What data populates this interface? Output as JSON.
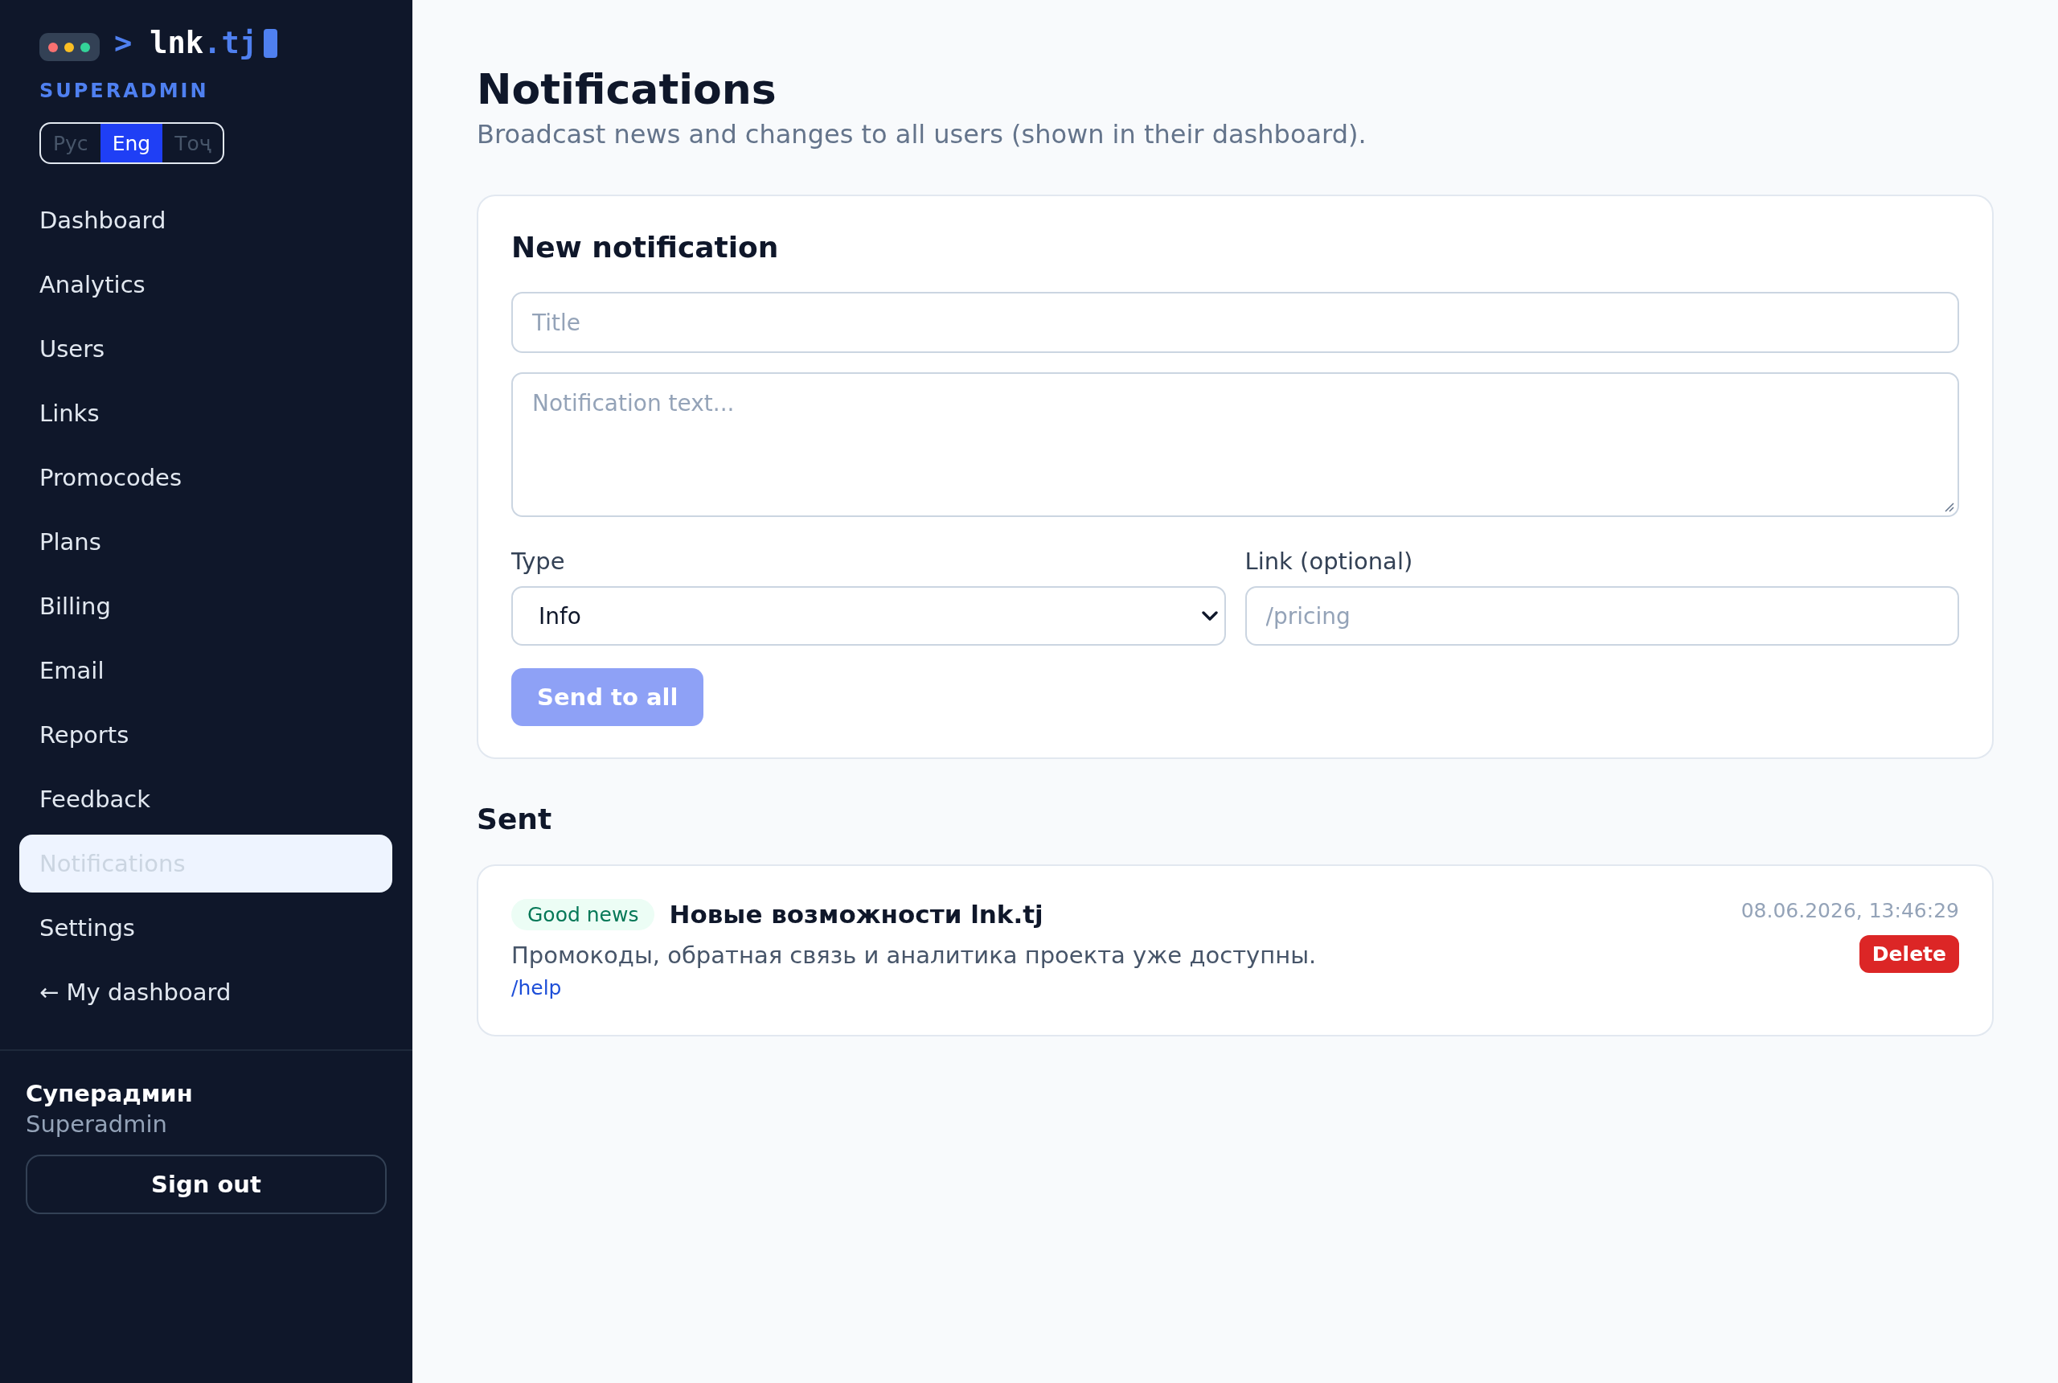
{
  "sidebar": {
    "logo": {
      "prompt": ">",
      "name": "lnk",
      "domain": ".tj"
    },
    "role": "SUPERADMIN",
    "languages": [
      {
        "label": "Рус",
        "selected": false
      },
      {
        "label": "Eng",
        "selected": true
      },
      {
        "label": "Тоҷ",
        "selected": false
      }
    ],
    "nav_items": [
      {
        "label": "Dashboard",
        "selected": false
      },
      {
        "label": "Analytics",
        "selected": false
      },
      {
        "label": "Users",
        "selected": false
      },
      {
        "label": "Links",
        "selected": false
      },
      {
        "label": "Promocodes",
        "selected": false
      },
      {
        "label": "Plans",
        "selected": false
      },
      {
        "label": "Billing",
        "selected": false
      },
      {
        "label": "Email",
        "selected": false
      },
      {
        "label": "Reports",
        "selected": false
      },
      {
        "label": "Feedback",
        "selected": false
      },
      {
        "label": "Notifications",
        "selected": true
      },
      {
        "label": "Settings",
        "selected": false
      },
      {
        "label": "← My dashboard",
        "selected": false
      }
    ],
    "user": {
      "name": "Суперадмин",
      "role": "Superadmin"
    },
    "sign_out_button": "Sign out"
  },
  "page": {
    "title": "Notifications",
    "subtitle": "Broadcast news and changes to all users (shown in their dashboard)."
  },
  "new_notification": {
    "heading": "New notification",
    "title_field": {
      "placeholder": "Title"
    },
    "text_field": {
      "placeholder": "Notification text..."
    },
    "type_field": {
      "label": "Type",
      "value": "Info"
    },
    "link_field": {
      "label": "Link (optional)",
      "placeholder": "/pricing"
    },
    "send_button": {
      "label": "Send to all",
      "disabled": true
    }
  },
  "sent": {
    "heading": "Sent",
    "notifications": [
      {
        "badge": "Good news",
        "kind": "success",
        "title": "Новые возможности lnk.tj",
        "text": "Промокоды, обратная связь и аналитика проекта уже доступны.",
        "link": "/help",
        "timestamp": "08.06.2026, 13:46:29",
        "delete_button": "Delete"
      }
    ]
  }
}
